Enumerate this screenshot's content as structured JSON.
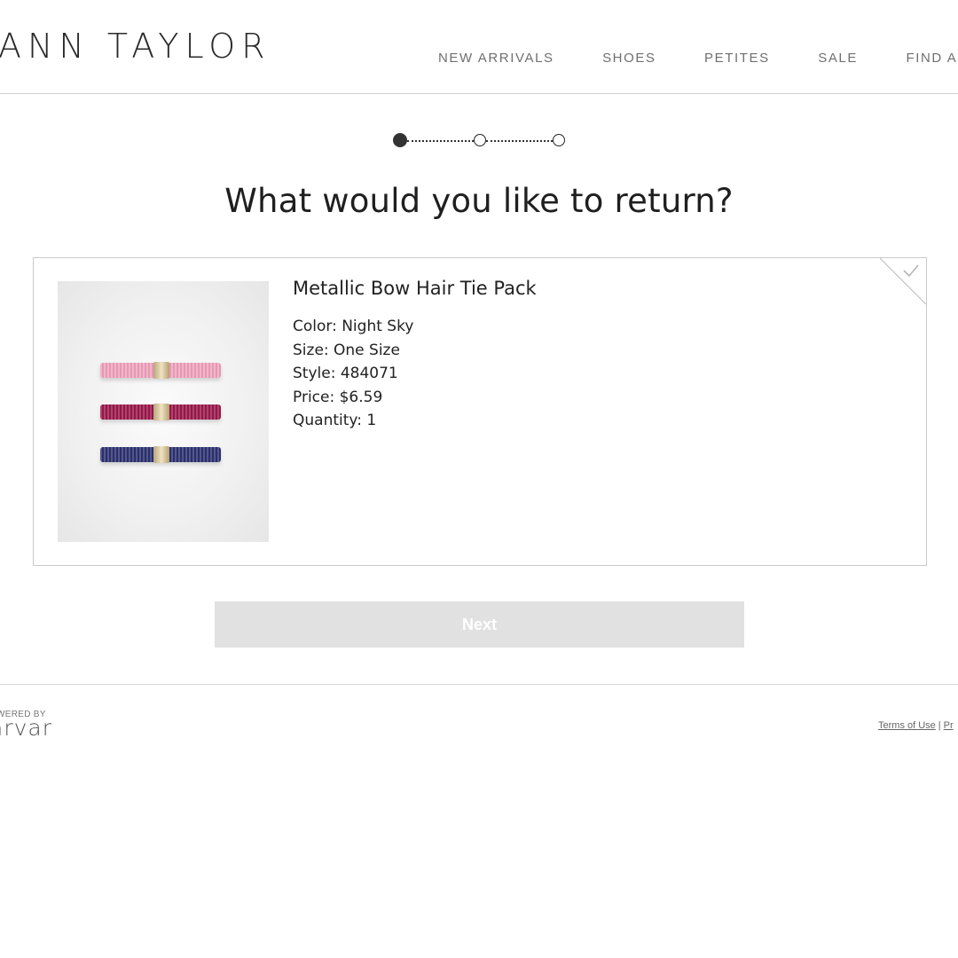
{
  "header": {
    "logo": "ANN TAYLOR",
    "nav": [
      "NEW ARRIVALS",
      "SHOES",
      "PETITES",
      "SALE",
      "FIND A ST"
    ]
  },
  "stepper": {
    "total_steps": 3,
    "current_step": 1
  },
  "page_title": "What would you like to return?",
  "item": {
    "name": "Metallic Bow Hair Tie Pack",
    "details": [
      "Color: Night Sky",
      "Size: One Size",
      "Style: 484071",
      "Price: $6.59",
      "Quantity: 1"
    ],
    "selected_icon": "checkmark-icon",
    "image_colors": [
      "#f1a3bd",
      "#9c1a4d",
      "#2d3272"
    ]
  },
  "next_button": {
    "label": "Next",
    "enabled": false
  },
  "footer": {
    "powered_by": "WERED BY",
    "brand": "arvar",
    "terms": "Terms of Use",
    "separator": "|",
    "privacy": "Pr"
  },
  "colors": {
    "accent": "#333333",
    "button_disabled": "#e1e1e1",
    "border": "#c9c9c9"
  }
}
